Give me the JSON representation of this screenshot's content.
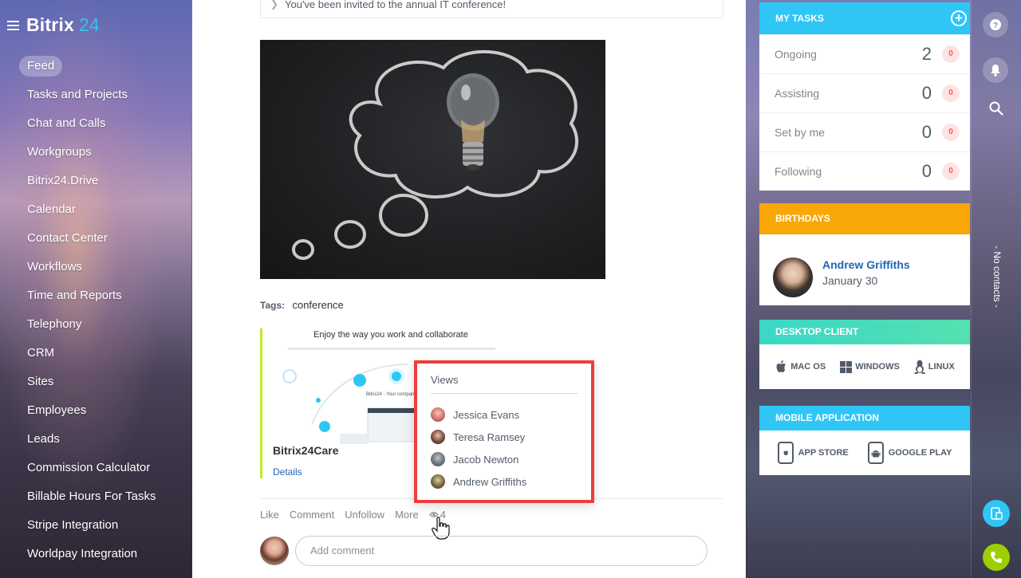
{
  "app": {
    "name": "Bitrix",
    "name_suffix": "24"
  },
  "sidebar": {
    "items": [
      {
        "label": "Feed",
        "active": true
      },
      {
        "label": "Tasks and Projects"
      },
      {
        "label": "Chat and Calls"
      },
      {
        "label": "Workgroups"
      },
      {
        "label": "Bitrix24.Drive"
      },
      {
        "label": "Calendar"
      },
      {
        "label": "Contact Center"
      },
      {
        "label": "Workflows"
      },
      {
        "label": "Time and Reports"
      },
      {
        "label": "Telephony"
      },
      {
        "label": "CRM"
      },
      {
        "label": "Sites"
      },
      {
        "label": "Employees"
      },
      {
        "label": "Leads"
      },
      {
        "label": "Commission Calculator"
      },
      {
        "label": "Billable Hours For Tasks"
      },
      {
        "label": "Stripe Integration"
      },
      {
        "label": "Worldpay Integration"
      }
    ]
  },
  "post": {
    "invite_text": "You've been invited to the annual IT conference!",
    "tags_label": "Tags:",
    "tag": "conference",
    "attachment": {
      "preview_title": "Enjoy the way you work and collaborate",
      "preview_caption": "Bitrix24 - Your company. United.",
      "name": "Bitrix24Care",
      "details_label": "Details"
    },
    "actions": {
      "like": "Like",
      "comment": "Comment",
      "unfollow": "Unfollow",
      "more": "More",
      "views_count": "4"
    },
    "comment_placeholder": "Add comment"
  },
  "views_popup": {
    "title": "Views",
    "viewers": [
      "Jessica Evans",
      "Teresa Ramsey",
      "Jacob Newton",
      "Andrew Griffiths"
    ]
  },
  "widgets": {
    "tasks": {
      "title": "MY TASKS",
      "rows": [
        {
          "label": "Ongoing",
          "count": "2",
          "badge": "0"
        },
        {
          "label": "Assisting",
          "count": "0",
          "badge": "0"
        },
        {
          "label": "Set by me",
          "count": "0",
          "badge": "0"
        },
        {
          "label": "Following",
          "count": "0",
          "badge": "0"
        }
      ]
    },
    "birthdays": {
      "title": "BIRTHDAYS",
      "name": "Andrew Griffiths",
      "date": "January 30"
    },
    "desktop": {
      "title": "DESKTOP CLIENT",
      "mac": "MAC OS",
      "windows": "WINDOWS",
      "linux": "LINUX"
    },
    "mobile": {
      "title": "MOBILE APPLICATION",
      "app_store": "APP STORE",
      "google_play": "GOOGLE PLAY"
    }
  },
  "right_bar": {
    "no_contacts": "- No contacts -"
  },
  "colors": {
    "accent": "#2fc6f6",
    "birthdays": "#f8a707",
    "desktop": "#3bd7c7",
    "highlight_border": "#ee3d3d",
    "badge": "#ff5752"
  }
}
